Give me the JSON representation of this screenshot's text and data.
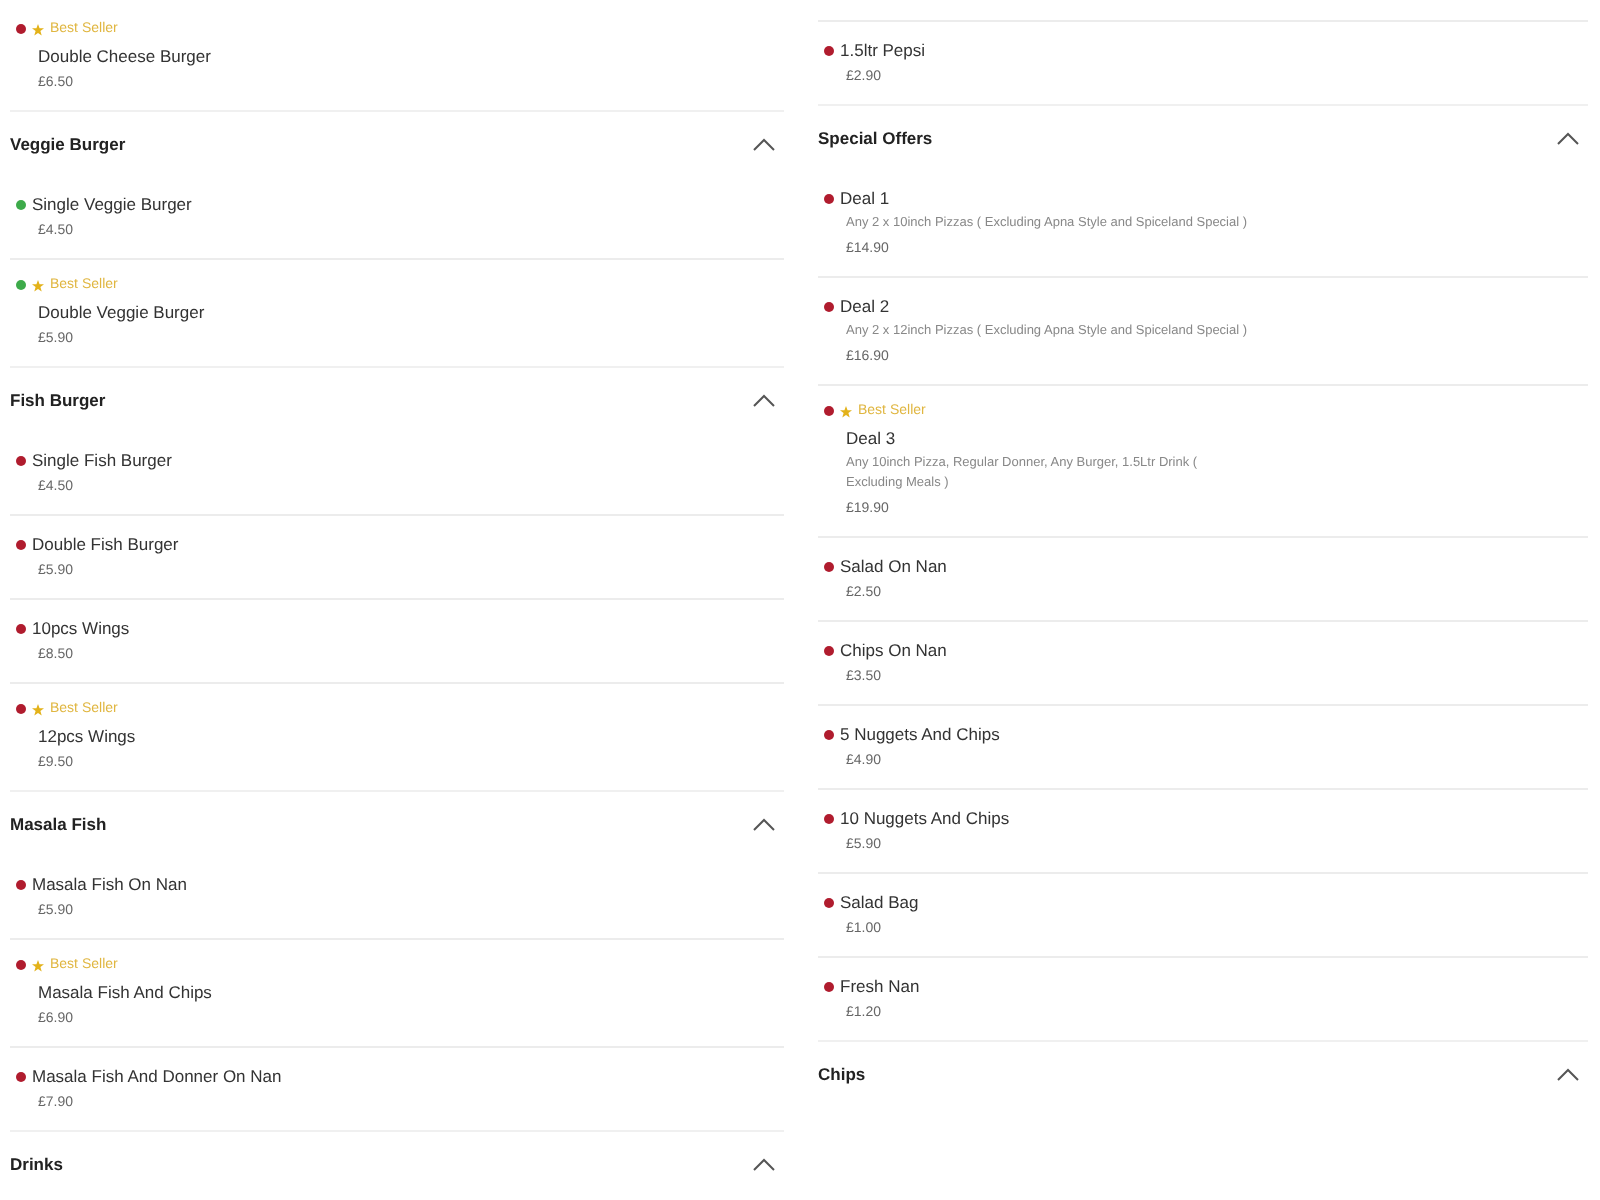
{
  "columns": [
    {
      "blocks": [
        {
          "kind": "item",
          "color": "#b01c2e",
          "badge": "Best Seller",
          "name": "Double Cheese Burger",
          "price": "£6.50"
        },
        {
          "kind": "header",
          "title": "Veggie Burger",
          "expanded": true
        },
        {
          "kind": "item",
          "color": "#3daa4a",
          "name": "Single Veggie Burger",
          "price": "£4.50"
        },
        {
          "kind": "item",
          "color": "#3daa4a",
          "badge": "Best Seller",
          "name": "Double Veggie Burger",
          "price": "£5.90"
        },
        {
          "kind": "header",
          "title": "Fish Burger",
          "expanded": true
        },
        {
          "kind": "item",
          "color": "#b01c2e",
          "name": "Single Fish Burger",
          "price": "£4.50"
        },
        {
          "kind": "item",
          "color": "#b01c2e",
          "name": "Double Fish Burger",
          "price": "£5.90"
        },
        {
          "kind": "item",
          "color": "#b01c2e",
          "name": "10pcs Wings",
          "price": "£8.50"
        },
        {
          "kind": "item",
          "color": "#b01c2e",
          "badge": "Best Seller",
          "name": "12pcs Wings",
          "price": "£9.50"
        },
        {
          "kind": "header",
          "title": "Masala Fish",
          "expanded": true
        },
        {
          "kind": "item",
          "color": "#b01c2e",
          "name": "Masala Fish On Nan",
          "price": "£5.90"
        },
        {
          "kind": "item",
          "color": "#b01c2e",
          "badge": "Best Seller",
          "name": "Masala Fish And Chips",
          "price": "£6.90"
        },
        {
          "kind": "item",
          "color": "#b01c2e",
          "name": "Masala Fish And Donner On Nan",
          "price": "£7.90"
        },
        {
          "kind": "header",
          "title": "Drinks",
          "expanded": true
        }
      ]
    },
    {
      "blocks": [
        {
          "kind": "item",
          "color": "#b01c2e",
          "name": "1.5ltr Pepsi",
          "price": "£2.90"
        },
        {
          "kind": "header",
          "title": "Special Offers",
          "expanded": true
        },
        {
          "kind": "item",
          "color": "#b01c2e",
          "name": "Deal 1",
          "description": "Any 2 x 10inch Pizzas ( Excluding Apna Style and Spiceland Special )",
          "price": "£14.90"
        },
        {
          "kind": "item",
          "color": "#b01c2e",
          "name": "Deal 2",
          "description": "Any 2 x 12inch Pizzas ( Excluding Apna Style and Spiceland Special )",
          "price": "£16.90"
        },
        {
          "kind": "item",
          "color": "#b01c2e",
          "badge": "Best Seller",
          "name": "Deal 3",
          "description": "Any 10inch Pizza, Regular Donner, Any Burger, 1.5Ltr Drink ( Excluding Meals )",
          "price": "£19.90"
        },
        {
          "kind": "item",
          "color": "#b01c2e",
          "name": "Salad On Nan",
          "price": "£2.50"
        },
        {
          "kind": "item",
          "color": "#b01c2e",
          "name": "Chips On Nan",
          "price": "£3.50"
        },
        {
          "kind": "item",
          "color": "#b01c2e",
          "name": "5 Nuggets And Chips",
          "price": "£4.90"
        },
        {
          "kind": "item",
          "color": "#b01c2e",
          "name": "10 Nuggets And Chips",
          "price": "£5.90"
        },
        {
          "kind": "item",
          "color": "#b01c2e",
          "name": "Salad Bag",
          "price": "£1.00"
        },
        {
          "kind": "item",
          "color": "#b01c2e",
          "name": "Fresh Nan",
          "price": "£1.20"
        },
        {
          "kind": "header",
          "title": "Chips",
          "expanded": true
        }
      ]
    }
  ]
}
